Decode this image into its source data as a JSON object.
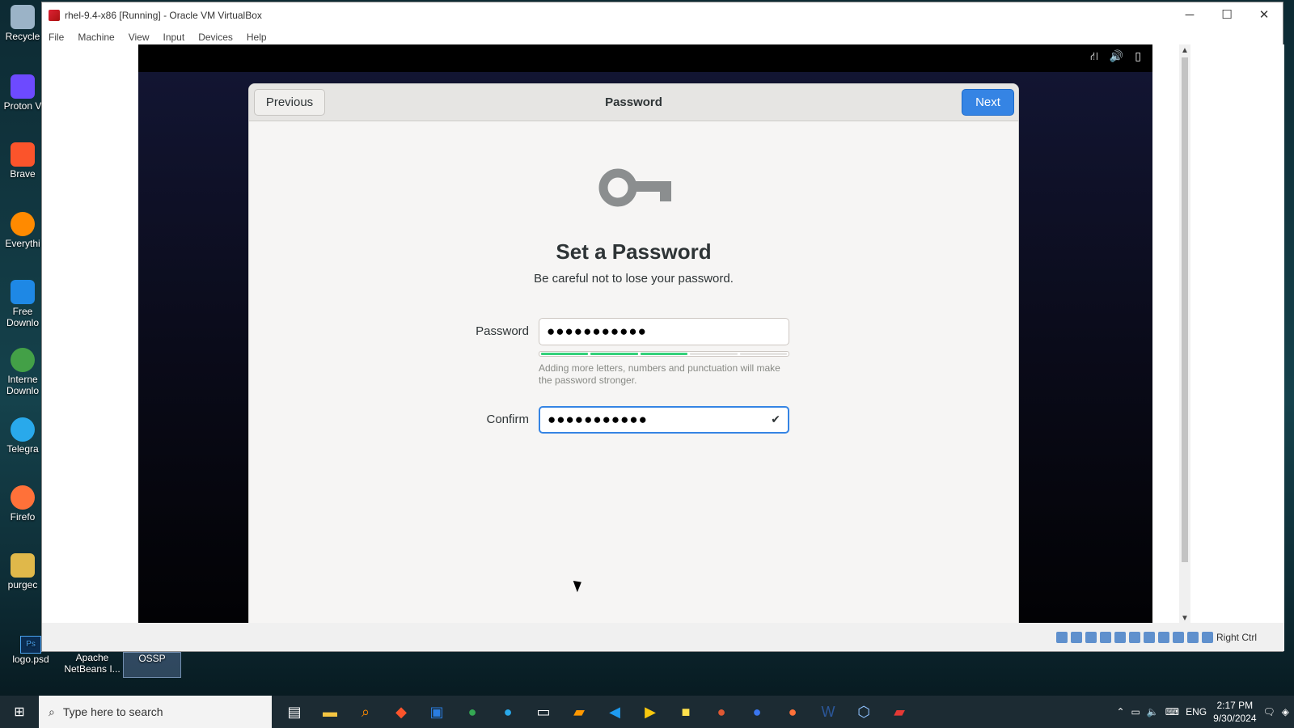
{
  "desktop": {
    "icons": [
      {
        "label": "Recycle",
        "color": "#9bb3c7"
      },
      {
        "label": "Proton V",
        "color": "#6d4aff"
      },
      {
        "label": "Brave",
        "color": "#fb542b"
      },
      {
        "label": "Everythi",
        "color": "#ff8a00"
      },
      {
        "label": "Free Downlo",
        "color": "#1e88e5"
      },
      {
        "label": "Interne Downlo",
        "color": "#43a047"
      },
      {
        "label": "Telegra",
        "color": "#29a9eb"
      },
      {
        "label": "Firefo",
        "color": "#ff7139"
      },
      {
        "label": "purgec",
        "color": "#e0b84a"
      }
    ],
    "bottom_icons": [
      "logo.psd",
      "Apache NetBeans I...",
      "OSSP"
    ]
  },
  "window": {
    "title": "rhel-9.4-x86 [Running] - Oracle VM VirtualBox",
    "menu": [
      "File",
      "Machine",
      "View",
      "Input",
      "Devices",
      "Help"
    ],
    "controls": {
      "minimize": "─",
      "maximize": "☐",
      "close": "✕"
    },
    "status_right": "Right Ctrl"
  },
  "guest": {
    "tray_icons": [
      "network-icon",
      "volume-icon",
      "battery-icon"
    ],
    "dialog": {
      "title": "Password",
      "previous_label": "Previous",
      "next_label": "Next",
      "heading": "Set a Password",
      "subtitle": "Be careful not to lose your password.",
      "password_label": "Password",
      "password_value": "●●●●●●●●●●●",
      "strength_level": 0.6,
      "hint": "Adding more letters, numbers and punctuation will make the password stronger.",
      "confirm_label": "Confirm",
      "confirm_value": "●●●●●●●●●●●"
    }
  },
  "taskbar": {
    "search_placeholder": "Type here to search",
    "language": "ENG",
    "time": "2:17 PM",
    "date": "9/30/2024",
    "accent": "#3584e4"
  }
}
